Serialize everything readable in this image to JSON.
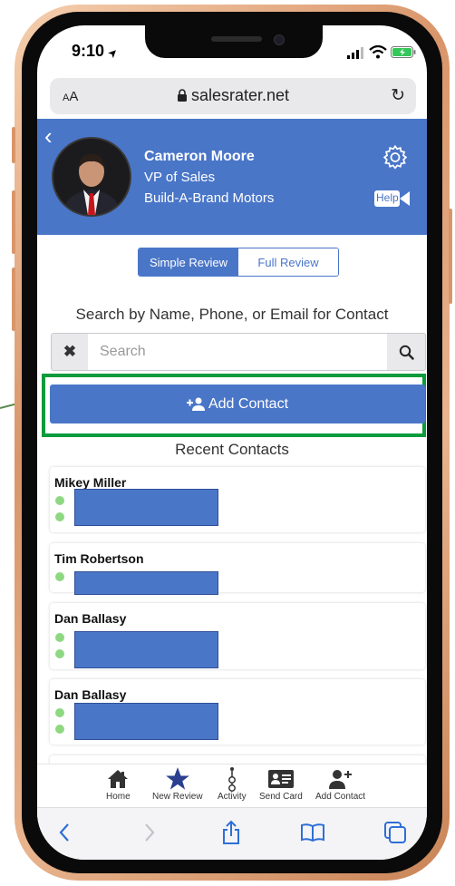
{
  "status_bar": {
    "time": "9:10",
    "location_glyph": "➤"
  },
  "browser": {
    "text_size_label": "AA",
    "url": "salesrater.net"
  },
  "profile": {
    "name": "Cameron Moore",
    "title": "VP of Sales",
    "company": "Build-A-Brand Motors",
    "help_label": "Help"
  },
  "review_toggle": {
    "simple": "Simple Review",
    "full": "Full Review",
    "active": "simple"
  },
  "search": {
    "label": "Search by Name, Phone, or Email for Contact",
    "placeholder": "Search",
    "value": ""
  },
  "add_contact_label": "Add Contact",
  "recent_title": "Recent Contacts",
  "contacts": [
    {
      "name": "Mikey Miller"
    },
    {
      "name": "Tim Robertson"
    },
    {
      "name": "Dan Ballasy"
    },
    {
      "name": "Dan Ballasy"
    }
  ],
  "bottom_nav": [
    {
      "label": "Home",
      "icon": "home-icon"
    },
    {
      "label": "New Review",
      "icon": "star-icon"
    },
    {
      "label": "Activity",
      "icon": "activity-icon"
    },
    {
      "label": "Send Card",
      "icon": "card-icon"
    },
    {
      "label": "Add Contact",
      "icon": "add-user-icon"
    }
  ],
  "colors": {
    "brand_blue": "#4a76c8",
    "highlight_green": "#0c9b3d",
    "status_dot": "#8fd882"
  }
}
